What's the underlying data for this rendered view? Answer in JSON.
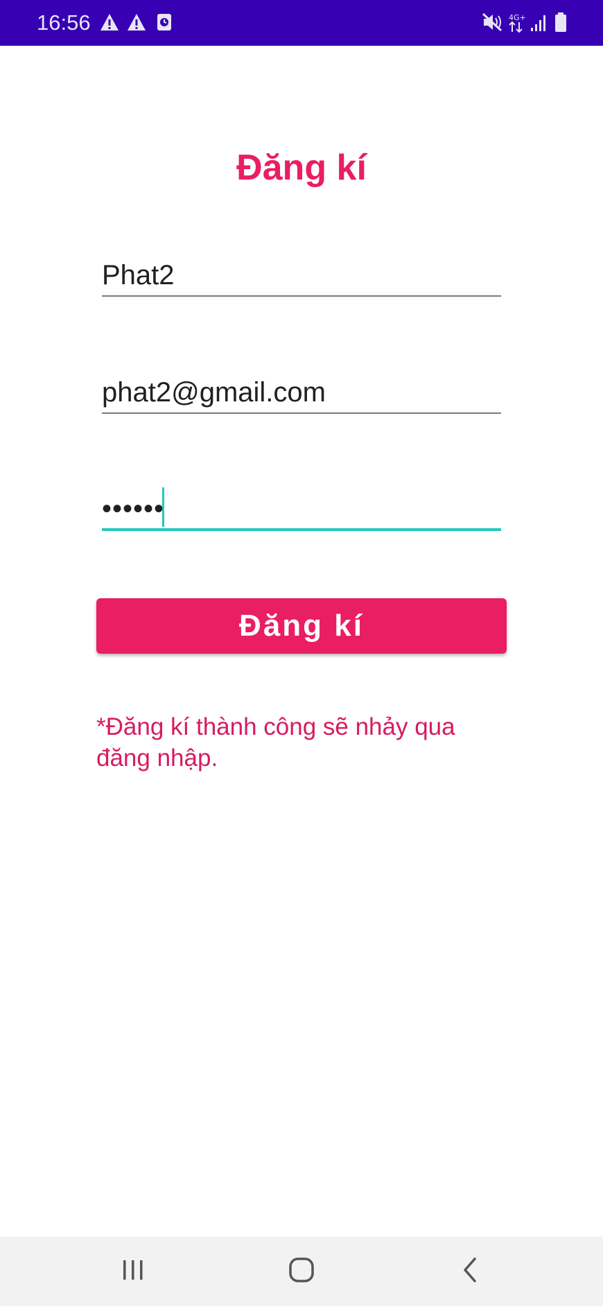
{
  "status_bar": {
    "time": "16:56",
    "left_icons": [
      "warning-icon",
      "warning-icon",
      "alarm-icon"
    ],
    "right_icons": [
      "mute-icon",
      "network-4g-icon",
      "signal-icon",
      "battery-icon"
    ],
    "network_label": "4G+",
    "background_color": "#3700b3"
  },
  "form": {
    "title": "Đăng kí",
    "name_value": "Phat2",
    "email_value": "phat2@gmail.com",
    "password_value": "••••••",
    "submit_label": "Đăng kí",
    "note": "*Đăng kí thành công sẽ nhảy qua đăng nhập.",
    "accent_color": "#e91e63",
    "focus_color": "#26c6c0"
  },
  "nav_bar": {
    "buttons": [
      "recents-icon",
      "home-icon",
      "back-icon"
    ]
  }
}
